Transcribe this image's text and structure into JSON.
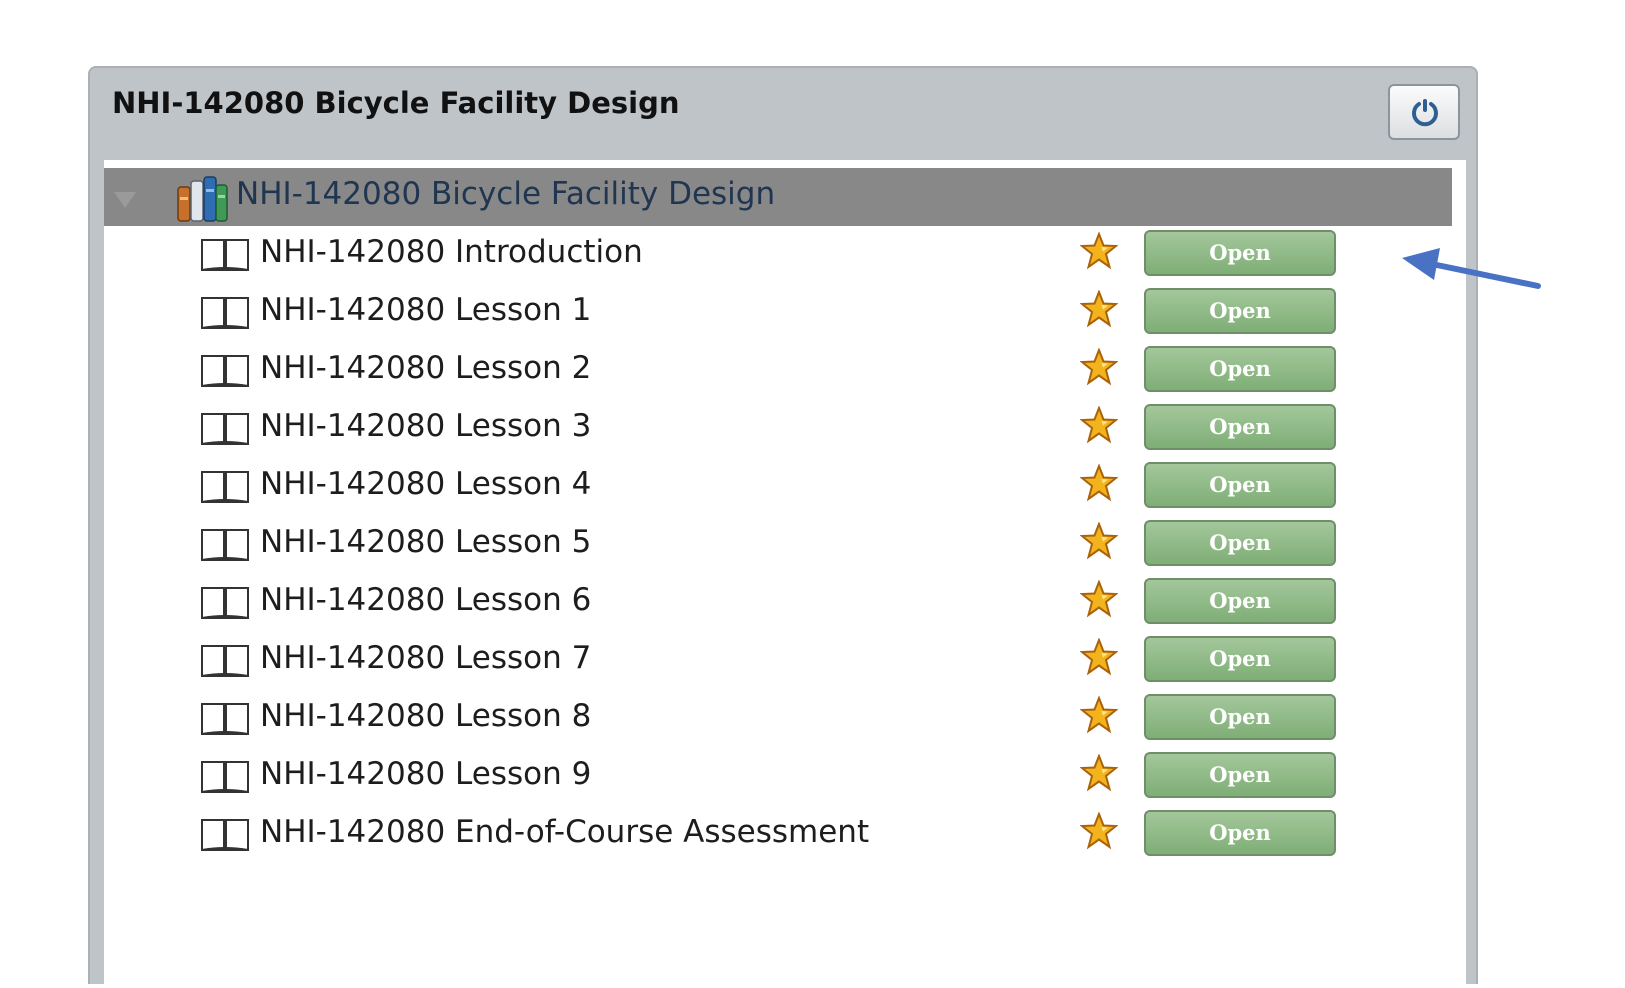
{
  "panel": {
    "title": "NHI-142080 Bicycle Facility Design",
    "refresh_icon": "refresh-icon"
  },
  "tree": {
    "root": {
      "label": "NHI-142080 Bicycle Facility Design",
      "icon": "library-books-icon",
      "expanded": true
    },
    "items": [
      {
        "label": "NHI-142080 Introduction",
        "button": "Open",
        "icon": "book-icon",
        "star": "star-icon"
      },
      {
        "label": "NHI-142080 Lesson 1",
        "button": "Open",
        "icon": "book-icon",
        "star": "star-icon"
      },
      {
        "label": "NHI-142080 Lesson 2",
        "button": "Open",
        "icon": "book-icon",
        "star": "star-icon"
      },
      {
        "label": "NHI-142080 Lesson 3",
        "button": "Open",
        "icon": "book-icon",
        "star": "star-icon"
      },
      {
        "label": "NHI-142080 Lesson 4",
        "button": "Open",
        "icon": "book-icon",
        "star": "star-icon"
      },
      {
        "label": "NHI-142080 Lesson 5",
        "button": "Open",
        "icon": "book-icon",
        "star": "star-icon"
      },
      {
        "label": "NHI-142080 Lesson 6",
        "button": "Open",
        "icon": "book-icon",
        "star": "star-icon"
      },
      {
        "label": "NHI-142080 Lesson 7",
        "button": "Open",
        "icon": "book-icon",
        "star": "star-icon"
      },
      {
        "label": "NHI-142080 Lesson 8",
        "button": "Open",
        "icon": "book-icon",
        "star": "star-icon"
      },
      {
        "label": "NHI-142080 Lesson 9",
        "button": "Open",
        "icon": "book-icon",
        "star": "star-icon"
      },
      {
        "label": "NHI-142080 End-of-Course Assessment",
        "button": "Open",
        "icon": "book-icon",
        "star": "star-icon"
      }
    ]
  },
  "colors": {
    "panel_bg": "#bfc4c9",
    "root_row_bg": "#888888",
    "open_button": "#8fbb86",
    "arrow": "#4a72c4",
    "star": "#f2b31c"
  }
}
